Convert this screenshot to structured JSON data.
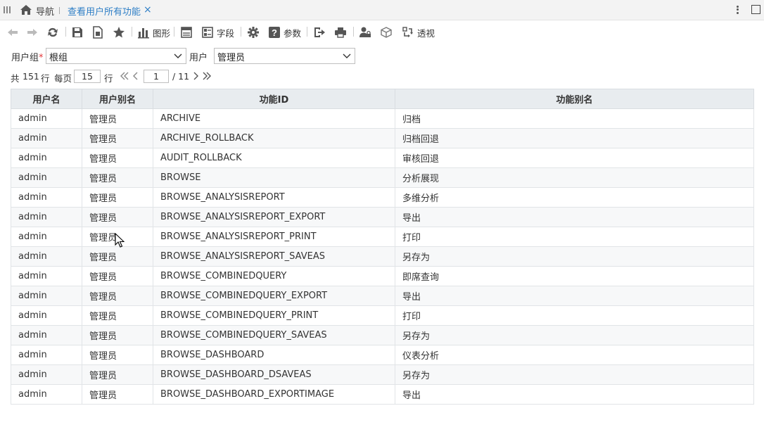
{
  "tabs": {
    "nav_label": "导航",
    "active_tab": "查看用户所有功能",
    "close_glyph": "×"
  },
  "toolbar": {
    "chart_label": "图形",
    "field_label": "字段",
    "param_label": "参数",
    "pivot_label": "透视"
  },
  "filters": {
    "user_group_label": "用户组",
    "required_mark": "*",
    "user_group_value": "根组",
    "user_label": "用户",
    "user_value": "管理员"
  },
  "pager": {
    "total_prefix": "共",
    "total_rows": "151",
    "total_suffix": "行",
    "per_page_label": "每页",
    "per_page_value": "15",
    "per_page_suffix": "行",
    "current_page": "1",
    "total_pages": "/ 11"
  },
  "table": {
    "columns": [
      "用户名",
      "用户别名",
      "功能ID",
      "功能别名"
    ],
    "rows": [
      [
        "admin",
        "管理员",
        "ARCHIVE",
        "归档"
      ],
      [
        "admin",
        "管理员",
        "ARCHIVE_ROLLBACK",
        "归档回退"
      ],
      [
        "admin",
        "管理员",
        "AUDIT_ROLLBACK",
        "审核回退"
      ],
      [
        "admin",
        "管理员",
        "BROWSE",
        "分析展现"
      ],
      [
        "admin",
        "管理员",
        "BROWSE_ANALYSISREPORT",
        "多维分析"
      ],
      [
        "admin",
        "管理员",
        "BROWSE_ANALYSISREPORT_EXPORT",
        "导出"
      ],
      [
        "admin",
        "管理员",
        "BROWSE_ANALYSISREPORT_PRINT",
        "打印"
      ],
      [
        "admin",
        "管理员",
        "BROWSE_ANALYSISREPORT_SAVEAS",
        "另存为"
      ],
      [
        "admin",
        "管理员",
        "BROWSE_COMBINEDQUERY",
        "即席查询"
      ],
      [
        "admin",
        "管理员",
        "BROWSE_COMBINEDQUERY_EXPORT",
        "导出"
      ],
      [
        "admin",
        "管理员",
        "BROWSE_COMBINEDQUERY_PRINT",
        "打印"
      ],
      [
        "admin",
        "管理员",
        "BROWSE_COMBINEDQUERY_SAVEAS",
        "另存为"
      ],
      [
        "admin",
        "管理员",
        "BROWSE_DASHBOARD",
        "仪表分析"
      ],
      [
        "admin",
        "管理员",
        "BROWSE_DASHBOARD_DSAVEAS",
        "另存为"
      ],
      [
        "admin",
        "管理员",
        "BROWSE_DASHBOARD_EXPORTIMAGE",
        "导出"
      ]
    ]
  },
  "colors": {
    "accent": "#2f7fc6",
    "header_bg": "#e8ecef",
    "required": "#e4393c"
  }
}
